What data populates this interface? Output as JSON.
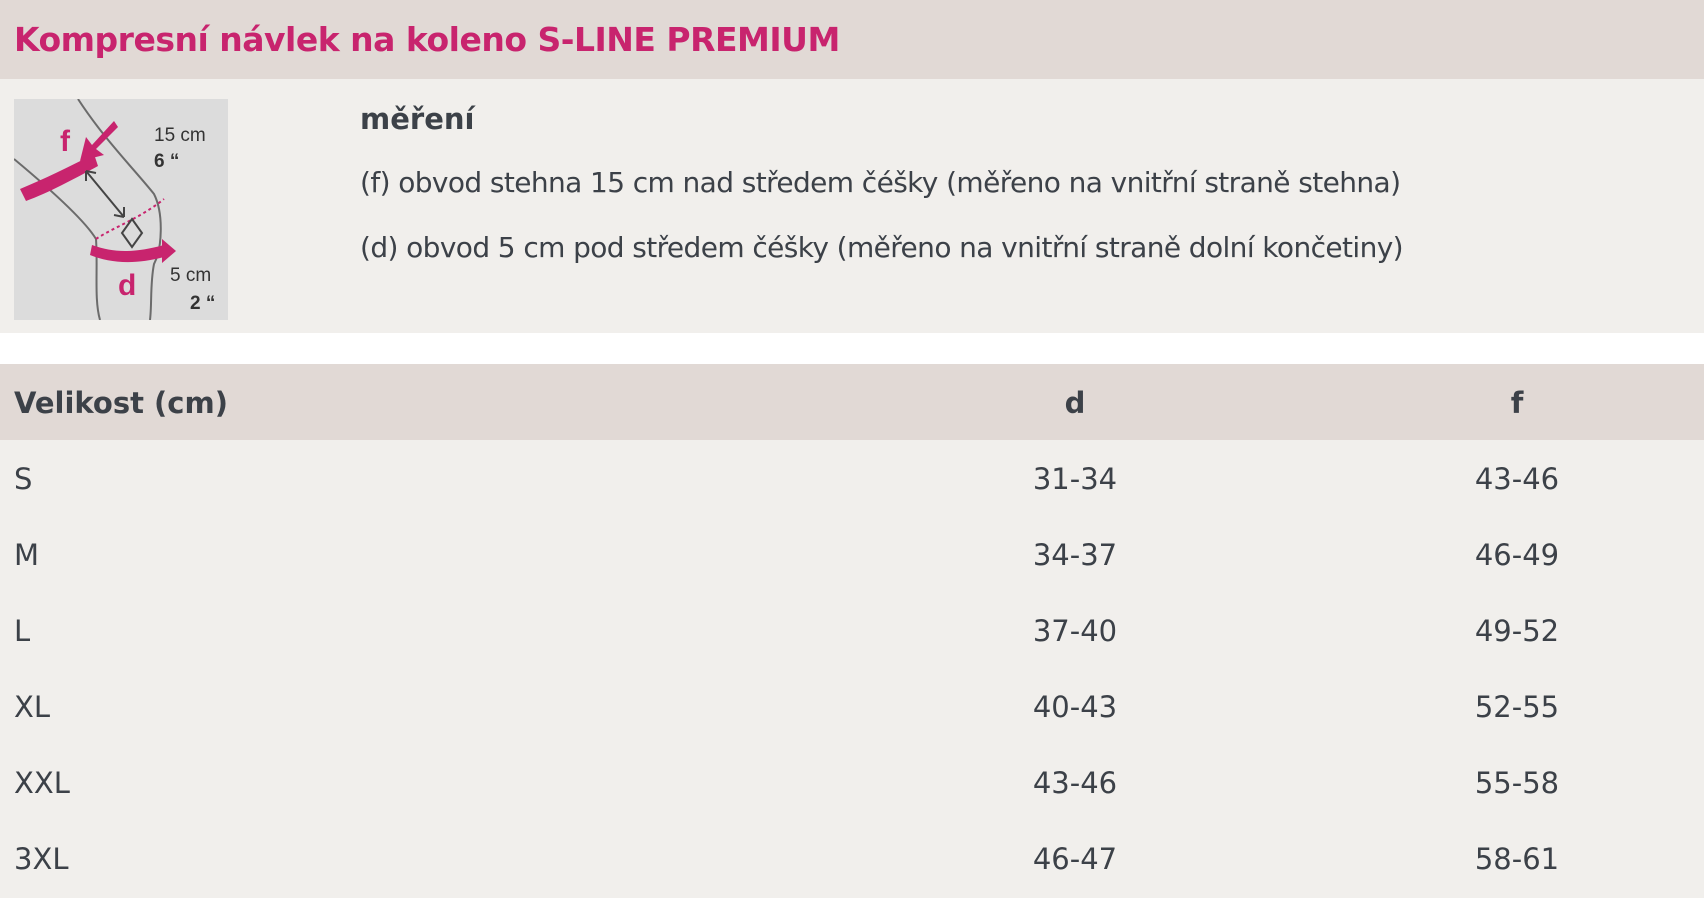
{
  "title": "Kompresní návlek na koleno S-LINE PREMIUM",
  "measurement": {
    "heading": "měření",
    "lines": [
      "(f) obvod stehna 15 cm nad středem čéšky (měřeno na vnitřní straně stehna)",
      "(d) obvod 5 cm pod středem čéšky (měřeno na vnitřní straně dolní končetiny)"
    ],
    "diagram": {
      "f_label": "f",
      "d_label": "d",
      "upper_cm": "15 cm",
      "upper_in": "6 “",
      "lower_cm": "5 cm",
      "lower_in": "2 “"
    }
  },
  "table": {
    "headers": [
      "Velikost (cm)",
      "d",
      "f"
    ],
    "rows": [
      [
        "S",
        "31-34",
        "43-46"
      ],
      [
        "M",
        "34-37",
        "46-49"
      ],
      [
        "L",
        "37-40",
        "49-52"
      ],
      [
        "XL",
        "40-43",
        "52-55"
      ],
      [
        "XXL",
        "43-46",
        "55-58"
      ],
      [
        "3XL",
        "46-47",
        "58-61"
      ]
    ]
  },
  "colors": {
    "accent": "#c8246e",
    "header_bg": "#e1d9d5",
    "panel_bg": "#f1efec",
    "text": "#3c4148"
  }
}
